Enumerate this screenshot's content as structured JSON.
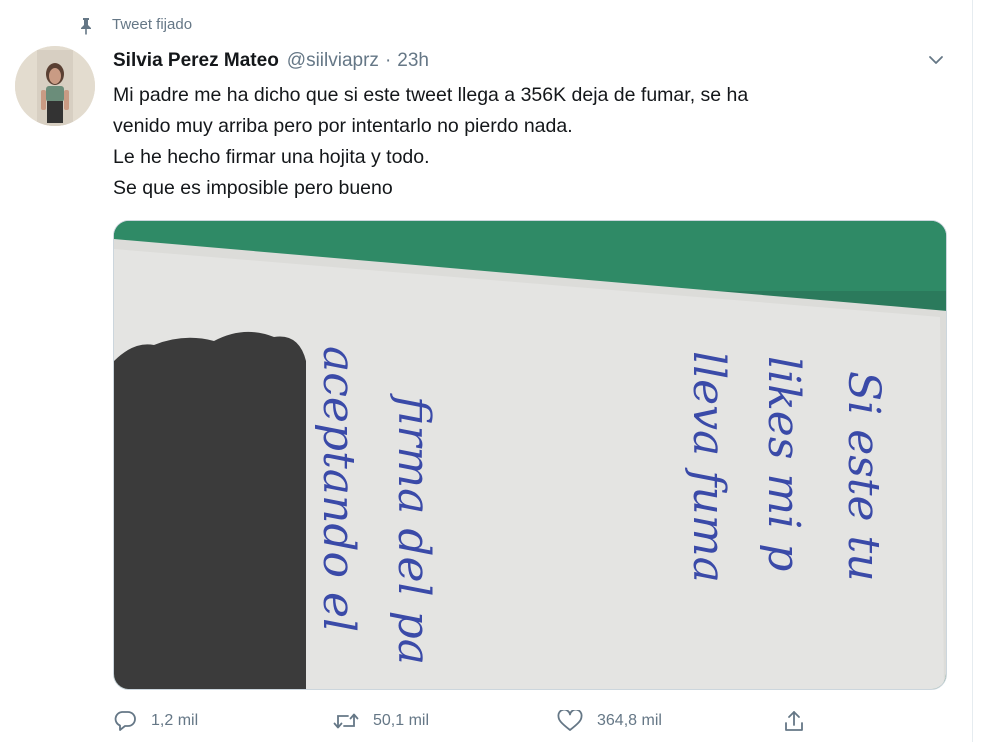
{
  "pinned_label": "Tweet fijado",
  "author": {
    "name": "Silvia Perez Mateo",
    "handle": "@siilviaprz",
    "separator": "·",
    "time": "23h"
  },
  "tweet": {
    "lines": [
      "Mi padre me ha dicho que si este tweet llega a 356K deja de fumar, se ha",
      "venido muy arriba pero por intentarlo no pierdo nada.",
      "Le he hecho firmar una hojita y todo.",
      "Se que es imposible pero bueno"
    ]
  },
  "media": {
    "handwritten_lines": [
      "Si este tu",
      "likes mi p",
      "lleva fuma",
      "firma del pa",
      "aceptando el"
    ]
  },
  "actions": {
    "replies": "1,2 mil",
    "retweets": "50,1 mil",
    "likes": "364,8 mil"
  },
  "icons": {
    "pin": "pin-icon",
    "caret": "chevron-down-icon",
    "reply": "reply-icon",
    "retweet": "retweet-icon",
    "like": "heart-icon",
    "share": "share-icon"
  },
  "colors": {
    "text_primary": "#14171a",
    "text_secondary": "#657786",
    "border": "#e6ecf0",
    "media_background": "#2b7a5c",
    "paper": "#e4e4e2",
    "ink": "#3a4aa8"
  }
}
